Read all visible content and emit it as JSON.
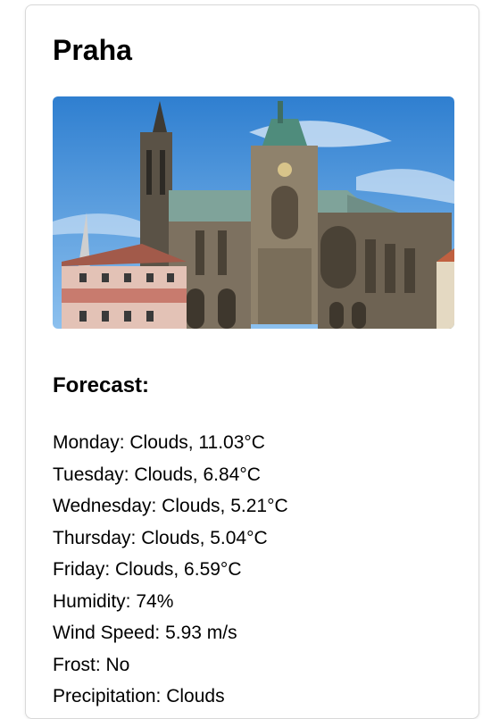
{
  "city": {
    "name": "Praha"
  },
  "photo": {
    "sky_color": "#3f8fd8",
    "stone_color": "#8f826c",
    "roof_color": "#7fa39a",
    "building_color": "#c87b6e"
  },
  "forecast": {
    "heading": "Forecast:",
    "lines": [
      "Monday: Clouds, 11.03°C",
      "Tuesday: Clouds, 6.84°C",
      "Wednesday: Clouds, 5.21°C",
      "Thursday: Clouds, 5.04°C",
      "Friday: Clouds, 6.59°C",
      "Humidity: 74%",
      "Wind Speed: 5.93 m/s",
      "Frost: No",
      "Precipitation: Clouds"
    ]
  }
}
